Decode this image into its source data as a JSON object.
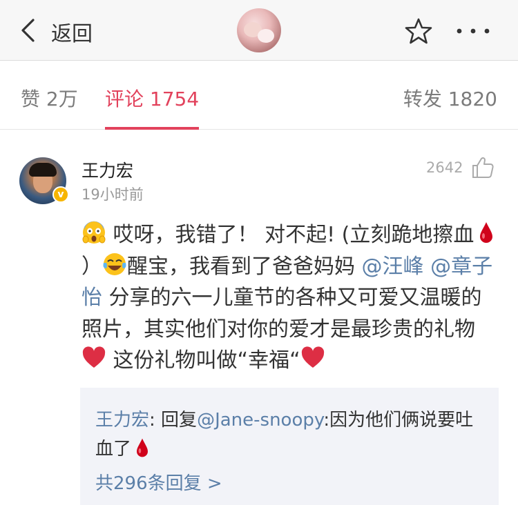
{
  "nav": {
    "back_label": "返回"
  },
  "tabs": {
    "likes": "赞 2万",
    "comments": "评论 1754",
    "reposts": "转发 1820"
  },
  "comment": {
    "username": "王力宏",
    "timestamp": "19小时前",
    "likes": "2642",
    "body": {
      "p1": "哎呀，我错了！ 对不起! (立刻跪地擦血",
      "p2": "）",
      "p3": "醒宝，我看到了爸爸妈妈 ",
      "mention1": "@汪峰",
      "mention2": "@章子怡",
      "p4": " 分享的六一儿童节的各种又可爱又温暖的照片，其实他们对你的爱才是最珍贵的礼物 ",
      "p5": " 这份礼物叫做“幸福“"
    },
    "reply": {
      "author": "王力宏",
      "sep": ": ",
      "reply_prefix": "回复",
      "mention": "@Jane-snoopy",
      "text": ":因为他们俩说要吐血了",
      "more": "共296条回复 >"
    }
  },
  "icons": {
    "back": "chevron-left-icon",
    "star": "star-icon",
    "more": "more-dots-icon",
    "like": "thumbs-up-icon"
  },
  "colors": {
    "accent": "#e2425c",
    "link": "#5b7fa8",
    "reply_bg": "#f2f3f8"
  }
}
